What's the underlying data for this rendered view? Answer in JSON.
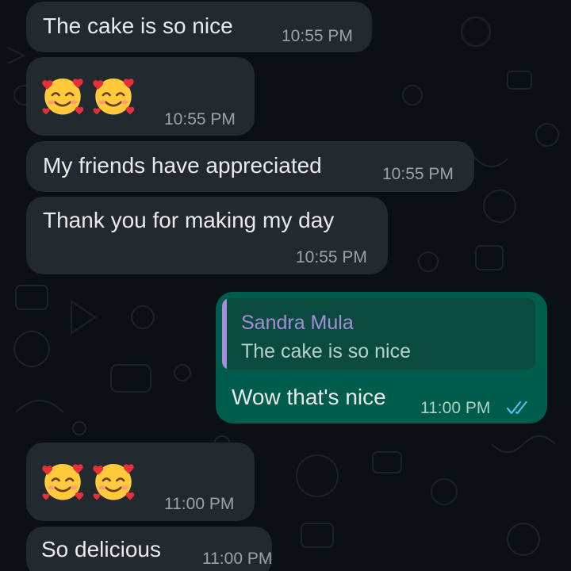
{
  "messages": [
    {
      "type": "text",
      "direction": "incoming",
      "text": "The cake is so nice",
      "time": "10:55 PM"
    },
    {
      "type": "emoji",
      "direction": "incoming",
      "emojis": [
        "smiling-face-with-hearts-icon",
        "smiling-face-with-hearts-icon"
      ],
      "time": "10:55 PM"
    },
    {
      "type": "text",
      "direction": "incoming",
      "text": "My friends have appreciated",
      "time": "10:55 PM"
    },
    {
      "type": "text",
      "direction": "incoming",
      "text": "Thank you for making my day",
      "time": "10:55 PM"
    },
    {
      "type": "reply",
      "direction": "outgoing",
      "quoted_author": "Sandra Mula",
      "quoted_text": "The cake is so nice",
      "text": "Wow that's nice",
      "time": "11:00 PM",
      "status": "read"
    },
    {
      "type": "emoji",
      "direction": "incoming",
      "emojis": [
        "smiling-face-with-hearts-icon",
        "smiling-face-with-hearts-icon"
      ],
      "time": "11:00 PM"
    },
    {
      "type": "text",
      "direction": "incoming",
      "text": "So delicious",
      "time": "11:00 PM"
    }
  ],
  "colors": {
    "background": "#0b1014",
    "incoming_bubble": "#232a2f",
    "outgoing_bubble": "#005c4b",
    "quote_author": "#a78bdc",
    "read_ticks": "#53bdeb"
  }
}
